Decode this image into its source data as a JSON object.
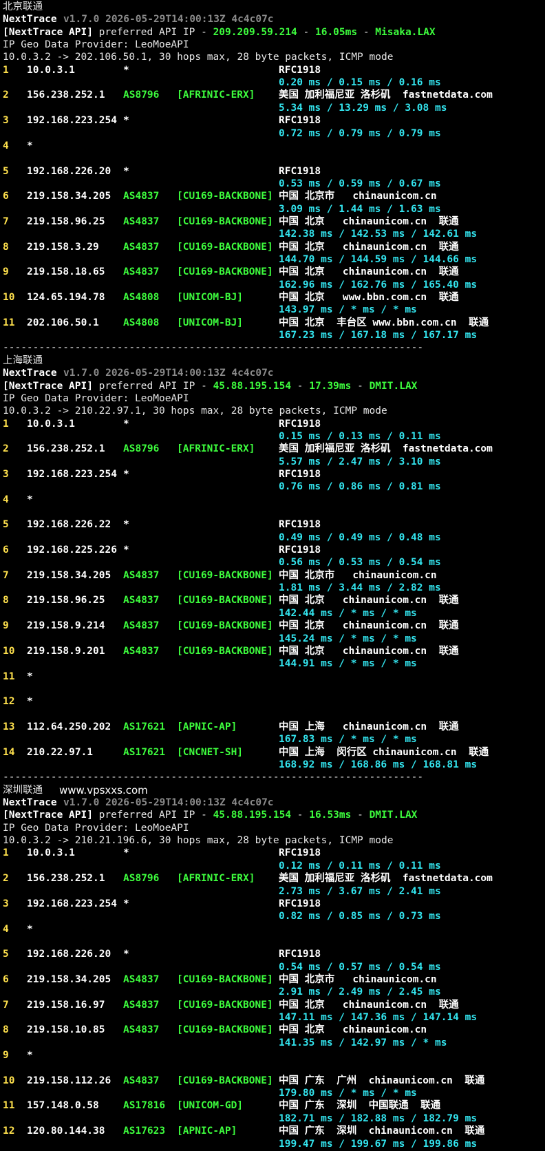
{
  "sections": [
    {
      "title": "北京联通",
      "site": "",
      "nt_label": "NextTrace",
      "version": "v1.7.0 2026-05-29T14:00:13Z 4c4c07c",
      "api_label": "[NextTrace API]",
      "api_pref": " preferred API IP - ",
      "api_ip": "209.209.59.214",
      "api_latency": "16.05ms",
      "api_node": "Misaka.LAX",
      "geo_line": "IP Geo Data Provider: LeoMoeAPI",
      "trace_line": "10.0.3.2 -> 202.106.50.1, 30 hops max, 28 byte packets, ICMP mode",
      "hops": [
        {
          "n": "1",
          "ip": "10.0.3.1",
          "asn": "*",
          "tag": "",
          "geo": "RFC1918",
          "rtt": "0.20 ms / 0.15 ms / 0.16 ms"
        },
        {
          "n": "2",
          "ip": "156.238.252.1",
          "asn": "AS8796",
          "tag": "[AFRINIC-ERX]",
          "geo": "美国 加利福尼亚 洛杉矶  fastnetdata.com",
          "rtt": "5.34 ms / 13.29 ms / 3.08 ms"
        },
        {
          "n": "3",
          "ip": "192.168.223.254",
          "asn": "*",
          "tag": "",
          "geo": "RFC1918",
          "rtt": "0.72 ms / 0.79 ms / 0.79 ms"
        },
        {
          "n": "4",
          "ip": "*",
          "asn": "",
          "tag": "",
          "geo": "",
          "rtt": ""
        },
        {
          "n": "5",
          "ip": "192.168.226.20",
          "asn": "*",
          "tag": "",
          "geo": "RFC1918",
          "rtt": "0.53 ms / 0.59 ms / 0.67 ms"
        },
        {
          "n": "6",
          "ip": "219.158.34.205",
          "asn": "AS4837",
          "tag": "[CU169-BACKBONE]",
          "geo": "中国 北京市   chinaunicom.cn",
          "rtt": "3.09 ms / 1.44 ms / 1.63 ms"
        },
        {
          "n": "7",
          "ip": "219.158.96.25",
          "asn": "AS4837",
          "tag": "[CU169-BACKBONE]",
          "geo": "中国 北京   chinaunicom.cn  联通",
          "rtt": "142.38 ms / 142.53 ms / 142.61 ms"
        },
        {
          "n": "8",
          "ip": "219.158.3.29",
          "asn": "AS4837",
          "tag": "[CU169-BACKBONE]",
          "geo": "中国 北京   chinaunicom.cn  联通",
          "rtt": "144.70 ms / 144.59 ms / 144.66 ms"
        },
        {
          "n": "9",
          "ip": "219.158.18.65",
          "asn": "AS4837",
          "tag": "[CU169-BACKBONE]",
          "geo": "中国 北京   chinaunicom.cn  联通",
          "rtt": "162.96 ms / 162.76 ms / 165.40 ms"
        },
        {
          "n": "10",
          "ip": "124.65.194.78",
          "asn": "AS4808",
          "tag": "[UNICOM-BJ]",
          "geo": "中国 北京   www.bbn.com.cn  联通",
          "rtt": "143.97 ms / * ms / * ms"
        },
        {
          "n": "11",
          "ip": "202.106.50.1",
          "asn": "AS4808",
          "tag": "[UNICOM-BJ]",
          "geo": "中国 北京  丰台区 www.bbn.com.cn  联通",
          "rtt": "167.23 ms / 167.18 ms / 167.17 ms"
        }
      ]
    },
    {
      "title": "上海联通",
      "site": "",
      "nt_label": "NextTrace",
      "version": "v1.7.0 2026-05-29T14:00:13Z 4c4c07c",
      "api_label": "[NextTrace API]",
      "api_pref": " preferred API IP - ",
      "api_ip": "45.88.195.154",
      "api_latency": "17.39ms",
      "api_node": "DMIT.LAX",
      "geo_line": "IP Geo Data Provider: LeoMoeAPI",
      "trace_line": "10.0.3.2 -> 210.22.97.1, 30 hops max, 28 byte packets, ICMP mode",
      "hops": [
        {
          "n": "1",
          "ip": "10.0.3.1",
          "asn": "*",
          "tag": "",
          "geo": "RFC1918",
          "rtt": "0.15 ms / 0.13 ms / 0.11 ms"
        },
        {
          "n": "2",
          "ip": "156.238.252.1",
          "asn": "AS8796",
          "tag": "[AFRINIC-ERX]",
          "geo": "美国 加利福尼亚 洛杉矶  fastnetdata.com",
          "rtt": "5.57 ms / 2.47 ms / 3.10 ms"
        },
        {
          "n": "3",
          "ip": "192.168.223.254",
          "asn": "*",
          "tag": "",
          "geo": "RFC1918",
          "rtt": "0.76 ms / 0.86 ms / 0.81 ms"
        },
        {
          "n": "4",
          "ip": "*",
          "asn": "",
          "tag": "",
          "geo": "",
          "rtt": ""
        },
        {
          "n": "5",
          "ip": "192.168.226.22",
          "asn": "*",
          "tag": "",
          "geo": "RFC1918",
          "rtt": "0.49 ms / 0.49 ms / 0.48 ms"
        },
        {
          "n": "6",
          "ip": "192.168.225.226",
          "asn": "*",
          "tag": "",
          "geo": "RFC1918",
          "rtt": "0.56 ms / 0.53 ms / 0.54 ms"
        },
        {
          "n": "7",
          "ip": "219.158.34.205",
          "asn": "AS4837",
          "tag": "[CU169-BACKBONE]",
          "geo": "中国 北京市   chinaunicom.cn",
          "rtt": "1.81 ms / 3.44 ms / 2.82 ms"
        },
        {
          "n": "8",
          "ip": "219.158.96.25",
          "asn": "AS4837",
          "tag": "[CU169-BACKBONE]",
          "geo": "中国 北京   chinaunicom.cn  联通",
          "rtt": "142.44 ms / * ms / * ms"
        },
        {
          "n": "9",
          "ip": "219.158.9.214",
          "asn": "AS4837",
          "tag": "[CU169-BACKBONE]",
          "geo": "中国 北京   chinaunicom.cn  联通",
          "rtt": "145.24 ms / * ms / * ms"
        },
        {
          "n": "10",
          "ip": "219.158.9.201",
          "asn": "AS4837",
          "tag": "[CU169-BACKBONE]",
          "geo": "中国 北京   chinaunicom.cn  联通",
          "rtt": "144.91 ms / * ms / * ms"
        },
        {
          "n": "11",
          "ip": "*",
          "asn": "",
          "tag": "",
          "geo": "",
          "rtt": ""
        },
        {
          "n": "12",
          "ip": "*",
          "asn": "",
          "tag": "",
          "geo": "",
          "rtt": ""
        },
        {
          "n": "13",
          "ip": "112.64.250.202",
          "asn": "AS17621",
          "tag": "[APNIC-AP]",
          "geo": "中国 上海   chinaunicom.cn  联通",
          "rtt": "167.83 ms / * ms / * ms"
        },
        {
          "n": "14",
          "ip": "210.22.97.1",
          "asn": "AS17621",
          "tag": "[CNCNET-SH]",
          "geo": "中国 上海  闵行区 chinaunicom.cn  联通",
          "rtt": "168.92 ms / 168.86 ms / 168.81 ms"
        }
      ]
    },
    {
      "title": "深圳联通",
      "site": "www.vpsxxs.com",
      "nt_label": "NextTrace",
      "version": "v1.7.0 2026-05-29T14:00:13Z 4c4c07c",
      "api_label": "[NextTrace API]",
      "api_pref": " preferred API IP - ",
      "api_ip": "45.88.195.154",
      "api_latency": "16.53ms",
      "api_node": "DMIT.LAX",
      "geo_line": "IP Geo Data Provider: LeoMoeAPI",
      "trace_line": "10.0.3.2 -> 210.21.196.6, 30 hops max, 28 byte packets, ICMP mode",
      "hops": [
        {
          "n": "1",
          "ip": "10.0.3.1",
          "asn": "*",
          "tag": "",
          "geo": "RFC1918",
          "rtt": "0.12 ms / 0.11 ms / 0.11 ms"
        },
        {
          "n": "2",
          "ip": "156.238.252.1",
          "asn": "AS8796",
          "tag": "[AFRINIC-ERX]",
          "geo": "美国 加利福尼亚 洛杉矶  fastnetdata.com",
          "rtt": "2.73 ms / 3.67 ms / 2.41 ms"
        },
        {
          "n": "3",
          "ip": "192.168.223.254",
          "asn": "*",
          "tag": "",
          "geo": "RFC1918",
          "rtt": "0.82 ms / 0.85 ms / 0.73 ms"
        },
        {
          "n": "4",
          "ip": "*",
          "asn": "",
          "tag": "",
          "geo": "",
          "rtt": ""
        },
        {
          "n": "5",
          "ip": "192.168.226.20",
          "asn": "*",
          "tag": "",
          "geo": "RFC1918",
          "rtt": "0.54 ms / 0.57 ms / 0.54 ms"
        },
        {
          "n": "6",
          "ip": "219.158.34.205",
          "asn": "AS4837",
          "tag": "[CU169-BACKBONE]",
          "geo": "中国 北京市   chinaunicom.cn",
          "rtt": "2.91 ms / 2.49 ms / 2.45 ms"
        },
        {
          "n": "7",
          "ip": "219.158.16.97",
          "asn": "AS4837",
          "tag": "[CU169-BACKBONE]",
          "geo": "中国 北京   chinaunicom.cn  联通",
          "rtt": "147.11 ms / 147.36 ms / 147.14 ms"
        },
        {
          "n": "8",
          "ip": "219.158.10.85",
          "asn": "AS4837",
          "tag": "[CU169-BACKBONE]",
          "geo": "中国 北京   chinaunicom.cn",
          "rtt": "141.35 ms / 142.97 ms / * ms"
        },
        {
          "n": "9",
          "ip": "*",
          "asn": "",
          "tag": "",
          "geo": "",
          "rtt": ""
        },
        {
          "n": "10",
          "ip": "219.158.112.26",
          "asn": "AS4837",
          "tag": "[CU169-BACKBONE]",
          "geo": "中国 广东  广州  chinaunicom.cn  联通",
          "rtt": "179.80 ms / * ms / * ms"
        },
        {
          "n": "11",
          "ip": "157.148.0.58",
          "asn": "AS17816",
          "tag": "[UNICOM-GD]",
          "geo": "中国 广东  深圳  中国联通  联通",
          "rtt": "182.71 ms / 182.88 ms / 182.79 ms"
        },
        {
          "n": "12",
          "ip": "120.80.144.38",
          "asn": "AS17623",
          "tag": "[APNIC-AP]",
          "geo": "中国 广东  深圳  chinaunicom.cn  联通",
          "rtt": "199.47 ms / 199.67 ms / 199.86 ms"
        }
      ]
    }
  ],
  "separator": "----------------------------------------------------------------------",
  "colors": {
    "background": "#000000",
    "hop_number": "#ffe14d",
    "asn": "#3dfc3d",
    "rtt": "#33e4ee",
    "version": "#8a8a8a"
  }
}
